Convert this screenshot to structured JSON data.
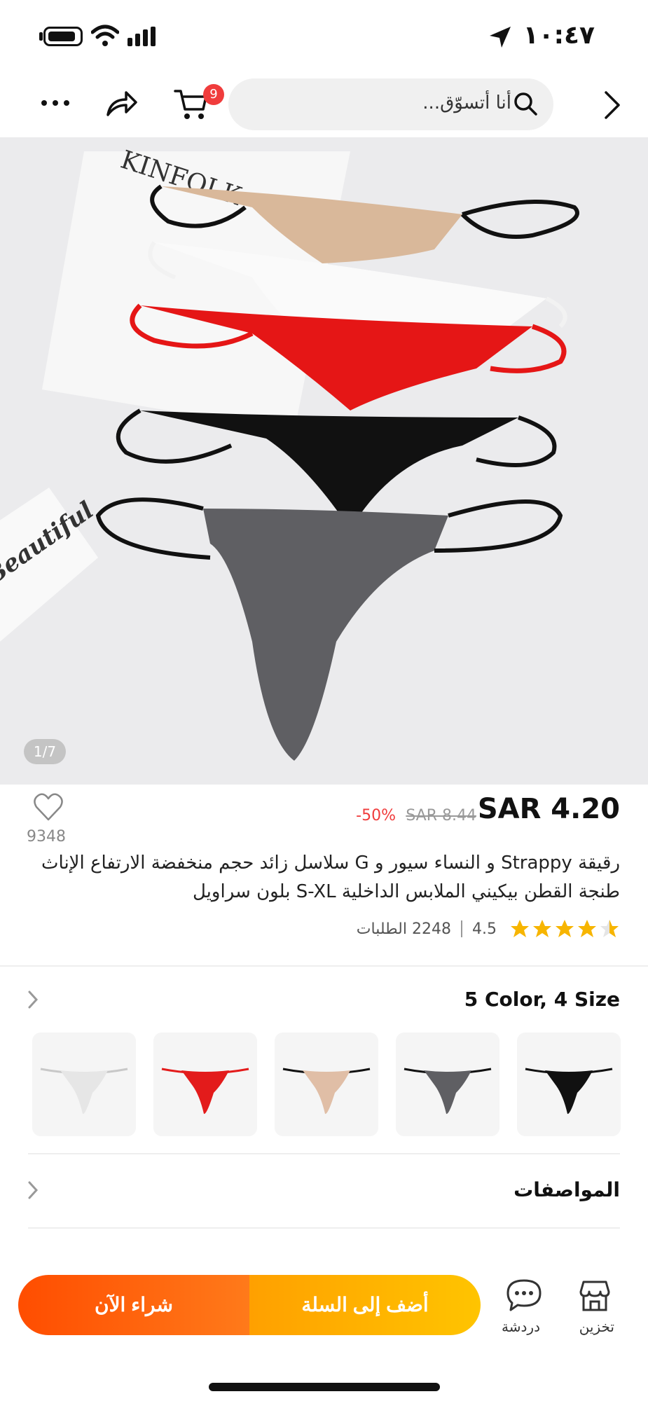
{
  "status_bar": {
    "time": "١٠:٤٧"
  },
  "nav": {
    "search_placeholder": "أنا أتسوّق...",
    "cart_badge": "9"
  },
  "hero": {
    "image_counter": "1/7",
    "book_text_1": "KINFOLK",
    "book_text_2": "Beautiful"
  },
  "product": {
    "price": "SAR 4.20",
    "original_price": "SAR 8.44",
    "discount": "-50%",
    "favorites": "9348",
    "title": "رقيقة Strappy و النساء سيور و G سلاسل زائد حجم منخفضة الارتفاع الإناث طنجة القطن بيكيني الملابس الداخلية S-XL بلون سراويل",
    "rating": "4.5",
    "stars": 4.5,
    "orders": "2248 الطلبات"
  },
  "variants": {
    "title": "5 Color, 4 Size",
    "colors": [
      "#111111",
      "#5f5f63",
      "#e0bea6",
      "#e31b1b",
      "#e6e6e6"
    ]
  },
  "specs": {
    "title": "المواصفات"
  },
  "bottom_bar": {
    "store_label": "تخزين",
    "chat_label": "دردشة",
    "add_to_cart": "أضف إلى السلة",
    "buy_now": "شراء الآن"
  }
}
